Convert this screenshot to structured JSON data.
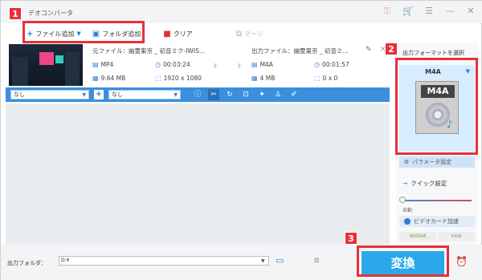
{
  "app": {
    "title": "デオコンバータ"
  },
  "window_controls": {
    "key": "⚿",
    "cart": "🛒",
    "menu": "☰",
    "minimize": "—",
    "close": "✕"
  },
  "toolbar": {
    "add_file": "ファイル追加",
    "add_folder": "フォルダ追加",
    "clear": "クリア",
    "merge": "マージ"
  },
  "file": {
    "source_label": "元ファイル：",
    "source_name": "幽霊東京 _ 初音ミク-IWIS...",
    "source_format": "MP4",
    "source_duration": "00:03:24",
    "source_size": "9.64 MB",
    "source_resolution": "1920 x 1080",
    "output_label": "出力ファイル：",
    "output_name": "幽霊東京 _ 初音ミ...",
    "output_format": "M4A",
    "output_duration": "00:01:57",
    "output_size": "4 MB",
    "output_resolution": "0 x 0"
  },
  "editbar": {
    "subtitle": "なし",
    "audio": "なし"
  },
  "right_panel": {
    "label": "出力フォーマットを選択",
    "format": "M4A",
    "format_icon_label": "M4A",
    "params_button": "パラメータ設定",
    "quick_settings": "クイック設定",
    "auto_label": "自動",
    "gpu_accel": "ビデオカード加速",
    "gpu_nvidia": "NVIDIA",
    "gpu_intel": "intel"
  },
  "bottom": {
    "output_folder_label": "出力フォルダ：",
    "output_folder_value": "D:¥",
    "convert_button": "変換"
  },
  "badges": {
    "one": "1",
    "two": "2",
    "three": "3"
  },
  "colors": {
    "accent": "#2d7dd2",
    "highlight": "#e8303a",
    "convert": "#2aa8ea",
    "editbar": "#3b8fdc"
  }
}
